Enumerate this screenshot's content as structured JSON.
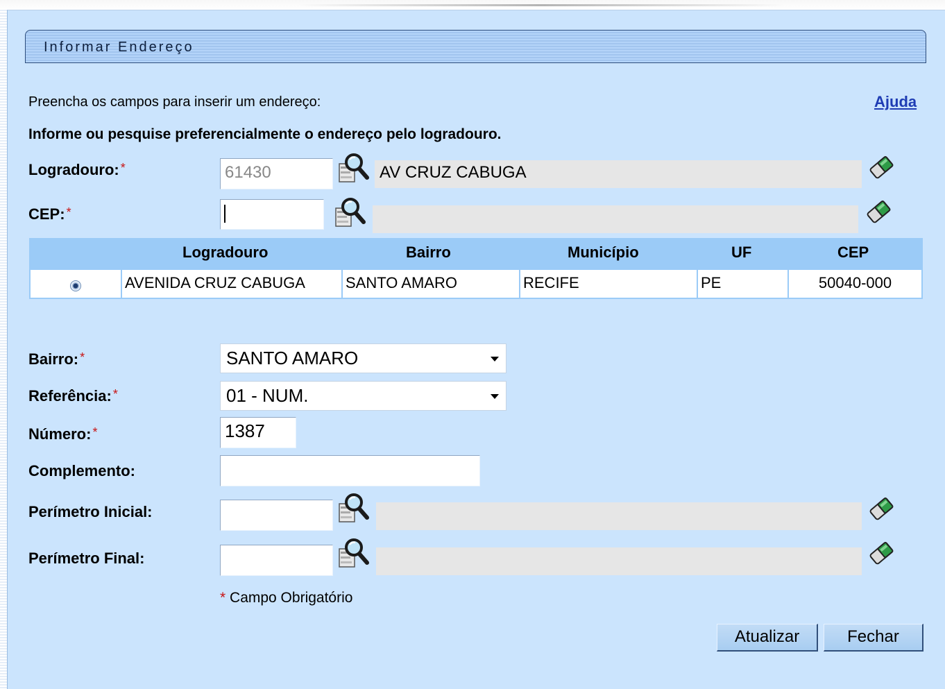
{
  "window": {
    "title": "Informar Endereço"
  },
  "instructions": {
    "line1": "Preencha os campos para inserir um endereço:",
    "line2": "Informe ou pesquise preferencialmente o endereço pelo logradouro.",
    "help_link": "Ajuda"
  },
  "required_marker": "*",
  "logradouro": {
    "label": "Logradouro:",
    "code": "61430",
    "name": "AV CRUZ CABUGA",
    "search_icon": "magnifier-document-icon",
    "clear_icon": "eraser-icon"
  },
  "cep": {
    "label": "CEP:",
    "code": "",
    "name": "",
    "search_icon": "magnifier-document-icon",
    "clear_icon": "eraser-icon"
  },
  "results_table": {
    "headers": [
      "Logradouro",
      "Bairro",
      "Município",
      "UF",
      "CEP"
    ],
    "rows": [
      {
        "selected": true,
        "logradouro": "AVENIDA CRUZ CABUGA",
        "bairro": "SANTO AMARO",
        "municipio": "RECIFE",
        "uf": "PE",
        "cep": "50040-000"
      }
    ]
  },
  "bairro": {
    "label": "Bairro:",
    "selected": "SANTO AMARO"
  },
  "referencia": {
    "label": "Referência:",
    "selected": "01 - NUM."
  },
  "numero": {
    "label": "Número:",
    "value": "1387"
  },
  "complemento": {
    "label": "Complemento:",
    "value": ""
  },
  "perimetro_inicial": {
    "label": "Perímetro Inicial:",
    "code": "",
    "name": ""
  },
  "perimetro_final": {
    "label": "Perímetro Final:",
    "code": "",
    "name": ""
  },
  "footer": {
    "required_note": "Campo Obrigatório",
    "update_button": "Atualizar",
    "close_button": "Fechar"
  },
  "colors": {
    "panel_bg": "#cbe4fd",
    "table_header_bg": "#9bcbf7",
    "link": "#1e3cb4",
    "required": "#c81414"
  }
}
